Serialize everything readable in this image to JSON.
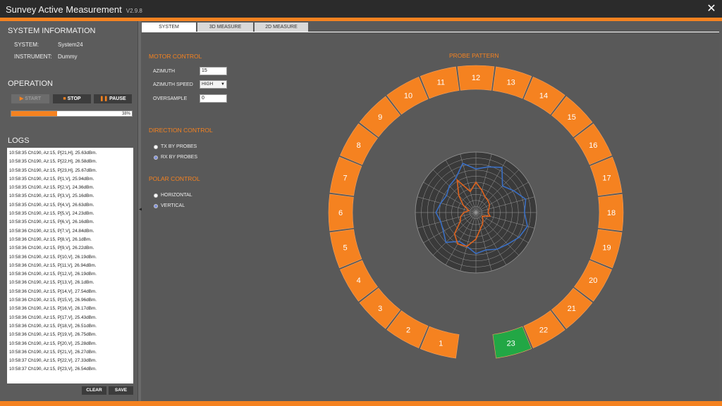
{
  "app": {
    "title": "Sunvey Active Measurement",
    "version": "V2.9.8",
    "close_label": "✕"
  },
  "system_info": {
    "heading": "SYSTEM INFORMATION",
    "system_label": "SYSTEM:",
    "system_value": "System24",
    "instrument_label": "INSTRUMENT:",
    "instrument_value": "Dummy"
  },
  "operation": {
    "heading": "OPERATION",
    "start_label": "START",
    "stop_label": "STOP",
    "pause_label": "PAUSE",
    "progress_percent": 38,
    "progress_text": "38%"
  },
  "logs": {
    "heading": "LOGS",
    "lines": [
      "10:58:35 Ch190, Az:15, P[21,H], 25.63dBm.",
      "10:58:35 Ch190, Az:15, P[22,H], 26.58dBm.",
      "10:58:35 Ch190, Az:15, P[23,H], 25.67dBm.",
      "10:58:35 Ch190, Az:15, P[1,V], 25.94dBm.",
      "10:58:35 Ch190, Az:15, P[2,V], 24.36dBm.",
      "10:58:35 Ch190, Az:15, P[3,V], 25.16dBm.",
      "10:58:35 Ch190, Az:15, P[4,V], 26.63dBm.",
      "10:58:35 Ch190, Az:15, P[5,V], 24.23dBm.",
      "10:58:35 Ch190, Az:15, P[6,V], 26.16dBm.",
      "10:58:36 Ch190, Az:15, P[7,V], 24.84dBm.",
      "10:58:36 Ch190, Az:15, P[8,V], 26.1dBm.",
      "10:58:36 Ch190, Az:15, P[9,V], 26.22dBm.",
      "10:58:36 Ch190, Az:15, P[10,V], 26.19dBm.",
      "10:58:36 Ch190, Az:15, P[11,V], 26.94dBm.",
      "10:58:36 Ch190, Az:15, P[12,V], 26.19dBm.",
      "10:58:36 Ch190, Az:15, P[13,V], 26.1dBm.",
      "10:58:36 Ch190, Az:15, P[14,V], 27.54dBm.",
      "10:58:36 Ch190, Az:15, P[15,V], 26.96dBm.",
      "10:58:36 Ch190, Az:15, P[16,V], 26.17dBm.",
      "10:58:36 Ch190, Az:15, P[17,V], 25.43dBm.",
      "10:58:36 Ch190, Az:15, P[18,V], 26.51dBm.",
      "10:58:36 Ch190, Az:15, P[19,V], 26.75dBm.",
      "10:58:36 Ch190, Az:15, P[20,V], 25.28dBm.",
      "10:58:36 Ch190, Az:15, P[21,V], 26.27dBm.",
      "10:58:37 Ch190, Az:15, P[22,V], 27.33dBm.",
      "10:58:37 Ch190, Az:15, P[23,V], 26.54dBm."
    ],
    "clear_label": "CLEAR",
    "save_label": "SAVE"
  },
  "tabs": {
    "system": "SYSTEM",
    "measure_3d": "3D MEASURE",
    "measure_2d": "2D MEASURE",
    "active": "SYSTEM"
  },
  "motor_control": {
    "heading": "MOTOR CONTROL",
    "azimuth_label": "AZIMUTH",
    "azimuth_value": "15",
    "speed_label": "AZIMUTH SPEED",
    "speed_value": "HIGH",
    "oversample_label": "OVERSAMPLE",
    "oversample_value": "0"
  },
  "direction_control": {
    "heading": "DIRECTION CONTROL",
    "options": [
      "TX BY PROBES",
      "RX BY PROBES"
    ],
    "selected": "RX BY PROBES"
  },
  "polar_control": {
    "heading": "POLAR CONTROL",
    "options": [
      "HORIZONTAL",
      "VERTICAL"
    ],
    "selected": "VERTICAL"
  },
  "probe_pattern": {
    "title": "PROBE PATTERN",
    "probes": [
      "1",
      "2",
      "3",
      "4",
      "5",
      "6",
      "7",
      "8",
      "9",
      "10",
      "11",
      "12",
      "13",
      "14",
      "15",
      "16",
      "17",
      "18",
      "19",
      "20",
      "21",
      "22",
      "23"
    ],
    "active_probe": "23",
    "colors": {
      "probe": "#f58220",
      "active": "#22a745",
      "series_blue": "#3a6fc4",
      "series_orange": "#e0641e"
    }
  },
  "chart_data": {
    "type": "polar",
    "title": "",
    "rings": 10,
    "spokes": 24,
    "series": [
      {
        "color": "#3a6fc4",
        "values": [
          0.72,
          0.78,
          0.86,
          0.62,
          0.72,
          0.85,
          0.8,
          0.88,
          0.82,
          0.74,
          0.7,
          0.64,
          0.68,
          0.58,
          0.55,
          0.7,
          0.62,
          0.6,
          0.66,
          0.6,
          0.56,
          0.62,
          0.66,
          0.84
        ]
      },
      {
        "color": "#e0641e",
        "values": [
          0.5,
          0.38,
          0.3,
          0.28,
          0.26,
          0.22,
          0.2,
          0.24,
          0.12,
          0.16,
          0.22,
          0.28,
          0.44,
          0.58,
          0.6,
          0.5,
          0.3,
          0.26,
          0.2,
          0.12,
          0.24,
          0.4,
          0.62,
          0.36
        ]
      }
    ]
  }
}
